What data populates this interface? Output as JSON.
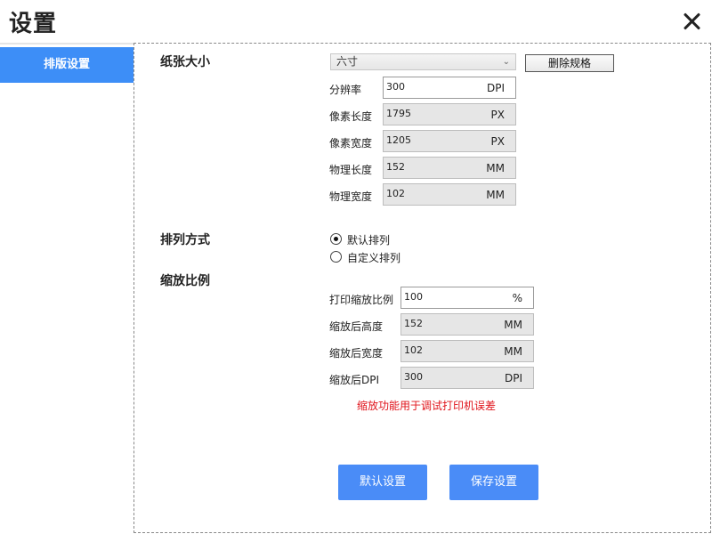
{
  "window": {
    "title": "设置"
  },
  "sidebar": {
    "items": [
      {
        "label": "排版设置"
      }
    ]
  },
  "paper": {
    "section_label": "纸张大小",
    "size_select": {
      "value": "六寸"
    },
    "delete_button": "删除规格",
    "resolution": {
      "label": "分辨率",
      "value": "300",
      "unit": "DPI"
    },
    "pixel_length": {
      "label": "像素长度",
      "value": "1795",
      "unit": "PX"
    },
    "pixel_width": {
      "label": "像素宽度",
      "value": "1205",
      "unit": "PX"
    },
    "physical_length": {
      "label": "物理长度",
      "value": "152",
      "unit": "MM"
    },
    "physical_width": {
      "label": "物理宽度",
      "value": "102",
      "unit": "MM"
    }
  },
  "arrangement": {
    "section_label": "排列方式",
    "options": [
      {
        "label": "默认排列",
        "checked": true
      },
      {
        "label": "自定义排列",
        "checked": false
      }
    ]
  },
  "scale": {
    "section_label": "缩放比例",
    "print_scale": {
      "label": "打印缩放比例",
      "value": "100",
      "unit": "%"
    },
    "scaled_height": {
      "label": "缩放后高度",
      "value": "152",
      "unit": "MM"
    },
    "scaled_width": {
      "label": "缩放后宽度",
      "value": "102",
      "unit": "MM"
    },
    "scaled_dpi": {
      "label": "缩放后DPI",
      "value": "300",
      "unit": "DPI"
    },
    "note": "缩放功能用于调试打印机误差"
  },
  "actions": {
    "default_button": "默认设置",
    "save_button": "保存设置"
  },
  "colors": {
    "accent": "#3d8ef7",
    "warning": "#e0141b",
    "readonly_bg": "#e6e6e6"
  }
}
